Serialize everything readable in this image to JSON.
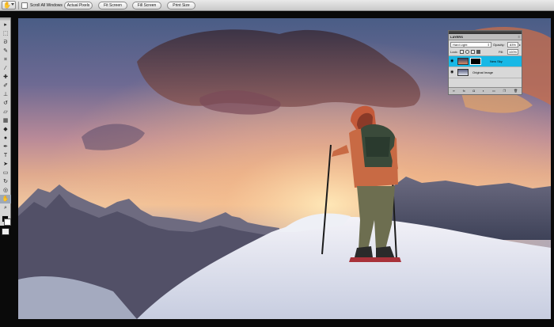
{
  "options_bar": {
    "tool_preset_icon": "hand-icon",
    "scroll_all_windows_label": "Scroll All Windows",
    "scroll_all_windows_checked": false,
    "buttons": [
      {
        "label": "Actual Pixels"
      },
      {
        "label": "Fit Screen"
      },
      {
        "label": "Fill Screen"
      },
      {
        "label": "Print Size"
      }
    ]
  },
  "tools_panel": {
    "tools": [
      {
        "name": "move-tool-icon",
        "glyph": "▸"
      },
      {
        "name": "marquee-tool-icon",
        "glyph": "⬚"
      },
      {
        "name": "lasso-tool-icon",
        "glyph": "ᘐ"
      },
      {
        "name": "quick-selection-tool-icon",
        "glyph": "✎"
      },
      {
        "name": "crop-tool-icon",
        "glyph": "⌗"
      },
      {
        "name": "eyedropper-tool-icon",
        "glyph": "⁄"
      },
      {
        "name": "healing-brush-tool-icon",
        "glyph": "✚"
      },
      {
        "name": "brush-tool-icon",
        "glyph": "✐"
      },
      {
        "name": "clone-stamp-tool-icon",
        "glyph": "⊥"
      },
      {
        "name": "history-brush-tool-icon",
        "glyph": "↺"
      },
      {
        "name": "eraser-tool-icon",
        "glyph": "▱"
      },
      {
        "name": "gradient-tool-icon",
        "glyph": "▦"
      },
      {
        "name": "blur-tool-icon",
        "glyph": "◆"
      },
      {
        "name": "dodge-tool-icon",
        "glyph": "●"
      },
      {
        "name": "pen-tool-icon",
        "glyph": "✒"
      },
      {
        "name": "type-tool-icon",
        "glyph": "T"
      },
      {
        "name": "path-selection-tool-icon",
        "glyph": "➤"
      },
      {
        "name": "rectangle-tool-icon",
        "glyph": "▭"
      },
      {
        "name": "3d-rotate-tool-icon",
        "glyph": "↻"
      },
      {
        "name": "3d-orbit-tool-icon",
        "glyph": "◎"
      },
      {
        "name": "hand-tool-icon",
        "glyph": "✋"
      },
      {
        "name": "zoom-tool-icon",
        "glyph": "⌕"
      }
    ],
    "active_tool": "hand-tool-icon",
    "foreground_color": "#000000",
    "background_color": "#ffffff"
  },
  "layers_panel": {
    "tab_label": "LAYERS",
    "blend_mode": "Hard Light",
    "opacity_label": "Opacity:",
    "opacity_value": "83%",
    "lock_label": "Lock:",
    "fill_label": "Fill:",
    "fill_value": "100%",
    "layers": [
      {
        "name": "New Sky",
        "selected": true,
        "visible": true,
        "has_mask": true
      },
      {
        "name": "Original Image",
        "selected": false,
        "visible": true,
        "has_mask": false
      }
    ],
    "footer_icons": [
      "link-layers-icon",
      "fx-icon",
      "add-mask-icon",
      "adjustment-layer-icon",
      "group-icon",
      "new-layer-icon",
      "trash-icon"
    ],
    "selected_color": "#18b8e6"
  }
}
